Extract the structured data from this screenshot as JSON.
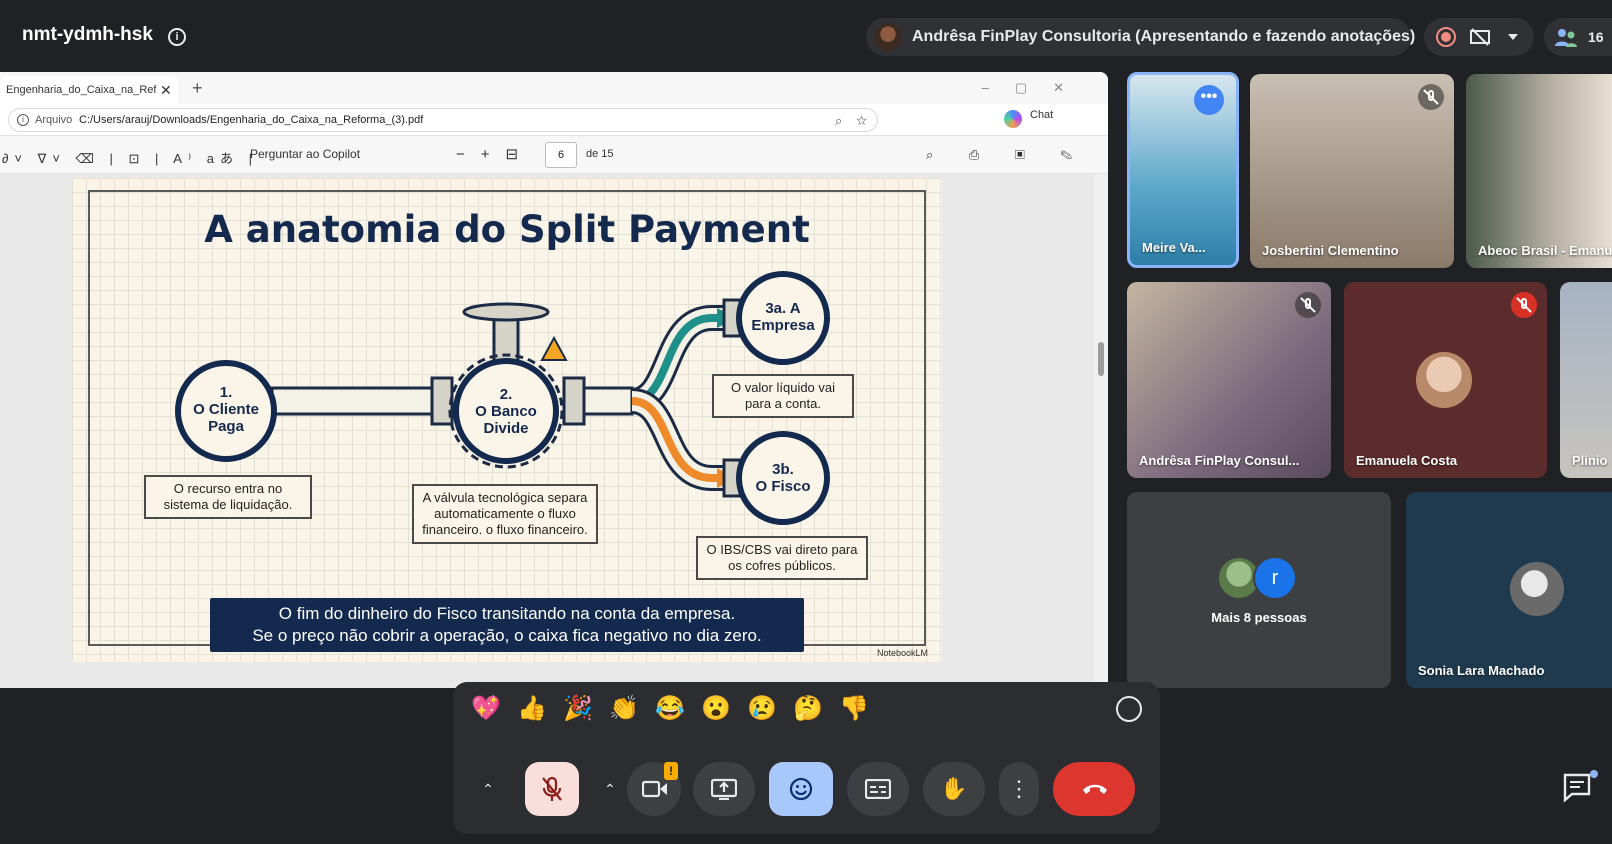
{
  "meeting": {
    "code": "nmt-ydmh-hsk",
    "presenter": "Andrêsa FinPlay Consultoria (Apresentando e fazendo anotações)",
    "participant_count": "16"
  },
  "browser": {
    "tab_title": "Engenharia_do_Caixa_na_Reforma_",
    "address_scheme": "Arquivo",
    "address_url": "C:/Users/arauj/Downloads/Engenharia_do_Caixa_na_Reforma_(3).pdf",
    "chat_label": "Chat"
  },
  "pdf_toolbar": {
    "copilot_label": "Perguntar ao Copilot",
    "page_current": "6",
    "page_total": "de 15"
  },
  "slide": {
    "title": "A anatomia do Split Payment",
    "step1": "1.\nO Cliente\nPaga",
    "step2": "2.\nO Banco\nDivide",
    "step3a": "3a. A\nEmpresa",
    "step3b": "3b.\nO Fisco",
    "note1": "O recurso entra no sistema de liquidação.",
    "note2": "A válvula tecnológica separa automaticamente o fluxo financeiro. o fluxo financeiro.",
    "note3a": "O valor líquido vai para a conta.",
    "note3b": "O IBS/CBS vai direto para os cofres públicos.",
    "banner_line1": "O fim do dinheiro do Fisco transitando na conta da empresa.",
    "banner_line2": "Se o preço não cobrir a operação, o caixa fica negativo no dia zero.",
    "watermark": "NotebookLM"
  },
  "participants": [
    {
      "name": "Meire Va...",
      "bg": "#5aa7c9"
    },
    {
      "name": "Josbertini Clementino",
      "bg": "#8a7a6a"
    },
    {
      "name": "Abeoc Brasil - Emanu",
      "bg": "#b9b1a6"
    },
    {
      "name": "Andrêsa FinPlay Consul...",
      "bg": "#7d6a7e"
    },
    {
      "name": "Emanuela Costa",
      "bg": "#5c2b2b"
    },
    {
      "name": "Plínio",
      "bg": "#c7c4be"
    },
    {
      "name": "Mais 8 pessoas",
      "bg": "#3c4043"
    },
    {
      "name": "Sonia Lara Machado",
      "bg": "#1f3a4f"
    }
  ],
  "more_people_initial": "r",
  "reactions": [
    "💖",
    "👍",
    "🎉",
    "👏",
    "😂",
    "😮",
    "😢",
    "🤔",
    "👎"
  ],
  "colors": {
    "slide_navy": "#14294e",
    "pipe_teal": "#1f8f8a",
    "pipe_orange": "#ef8a2a",
    "end_call": "#dc362e",
    "reaction_active": "#a8c7fa"
  }
}
